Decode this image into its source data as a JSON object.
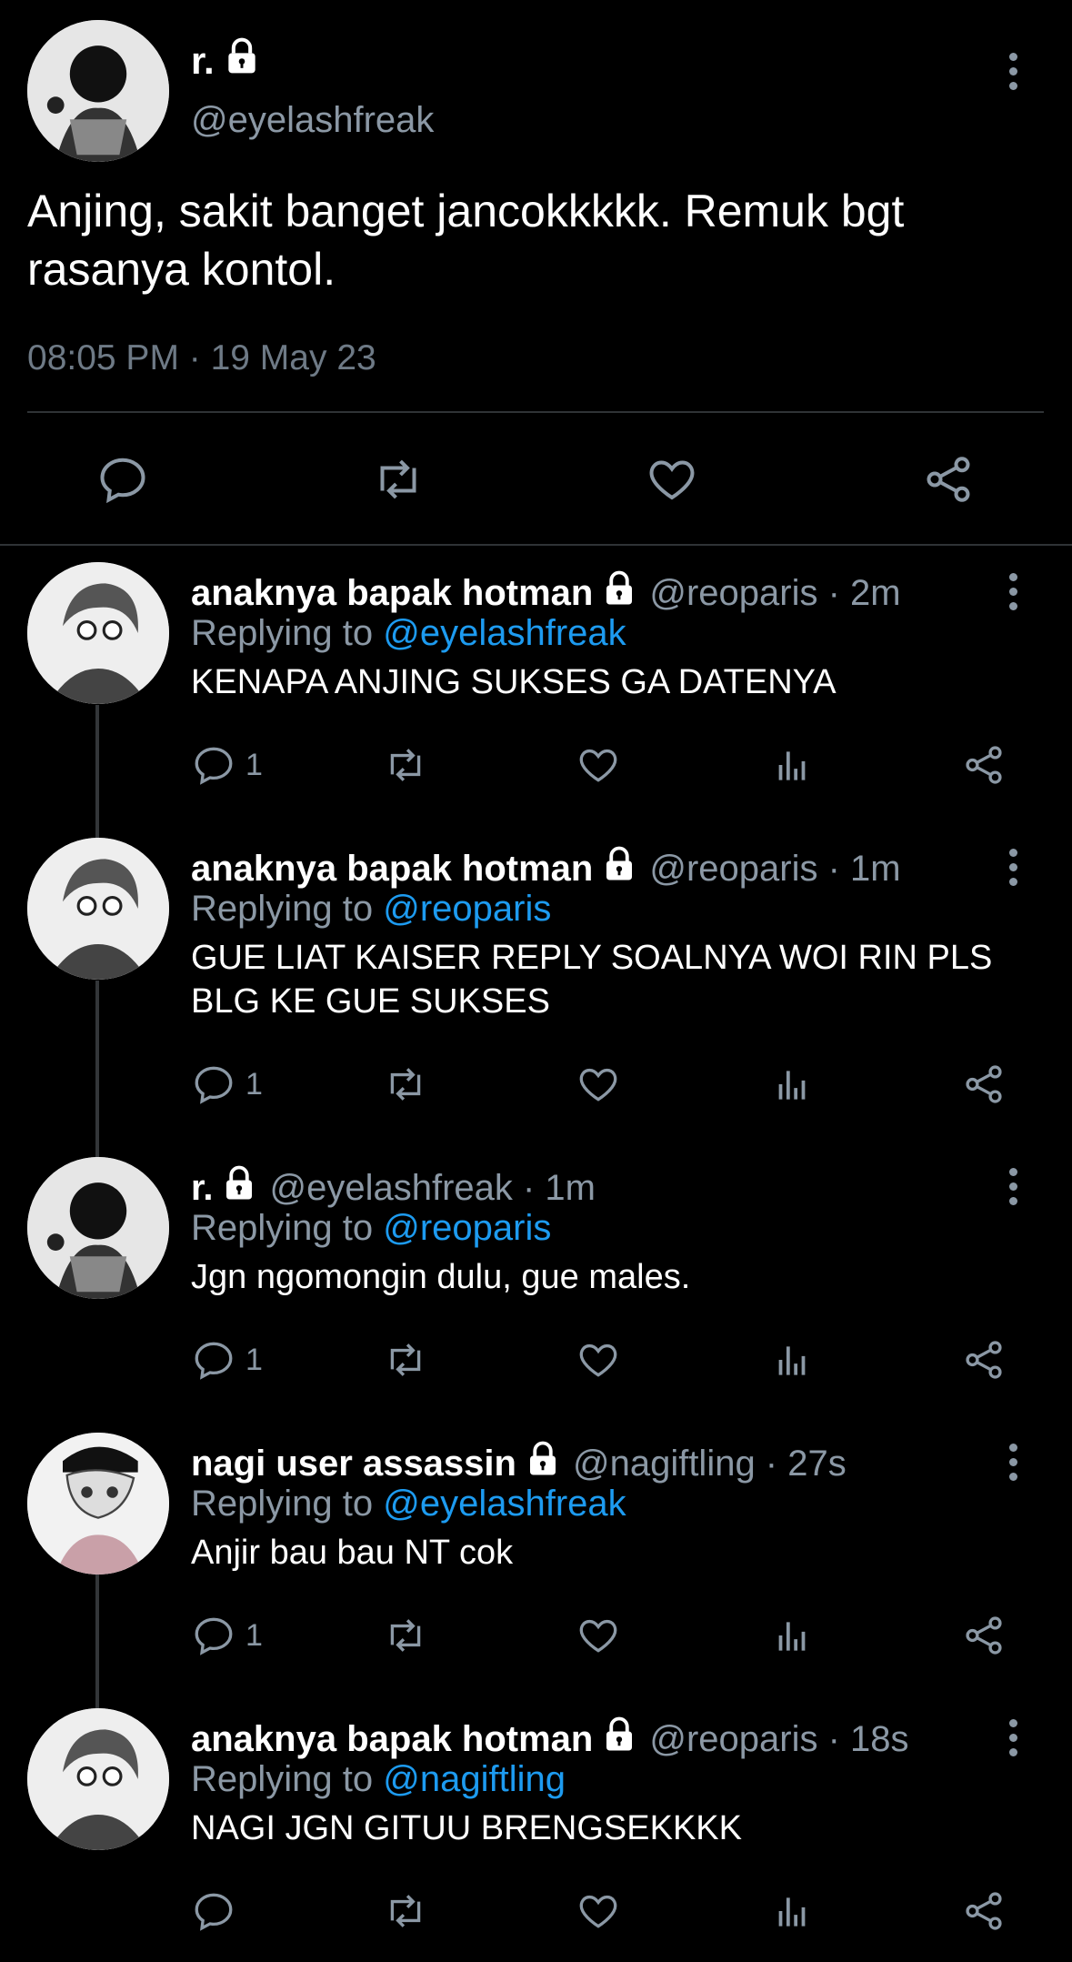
{
  "main": {
    "name": "r.",
    "handle": "@eyelashfreak",
    "text": "Anjing, sakit banget jancokkkkk. Remuk bgt rasanya kontol.",
    "timestamp": "08:05 PM · 19 May 23"
  },
  "replies": [
    {
      "name": "anaknya bapak hotman",
      "handle": "@reoparis · 2m",
      "replying_prefix": "Replying to ",
      "replying_to": "@eyelashfreak",
      "text": "KENAPA ANJING SUKSES GA DATENYA",
      "reply_count": "1"
    },
    {
      "name": "anaknya bapak hotman",
      "handle": "@reoparis · 1m",
      "replying_prefix": "Replying to ",
      "replying_to": "@reoparis",
      "text": "GUE LIAT KAISER REPLY SOALNYA WOI RIN PLS BLG KE GUE SUKSES",
      "reply_count": "1"
    },
    {
      "name": "r.",
      "handle": "@eyelashfreak · 1m",
      "replying_prefix": "Replying to ",
      "replying_to": "@reoparis",
      "text": "Jgn ngomongin dulu, gue males.",
      "reply_count": "1"
    },
    {
      "name": "nagi user assassin",
      "handle": "@nagiftling · 27s",
      "replying_prefix": "Replying to ",
      "replying_to": "@eyelashfreak",
      "text": "Anjir bau bau NT cok",
      "reply_count": "1"
    },
    {
      "name": "anaknya bapak hotman",
      "handle": "@reoparis · 18s",
      "replying_prefix": "Replying to ",
      "replying_to": "@nagiftling",
      "text": "NAGI JGN GITUU BRENGSEKKKK",
      "reply_count": ""
    }
  ],
  "colors": {
    "background": "#000000",
    "muted": "#8b98a5",
    "accent": "#1d9bf0"
  }
}
